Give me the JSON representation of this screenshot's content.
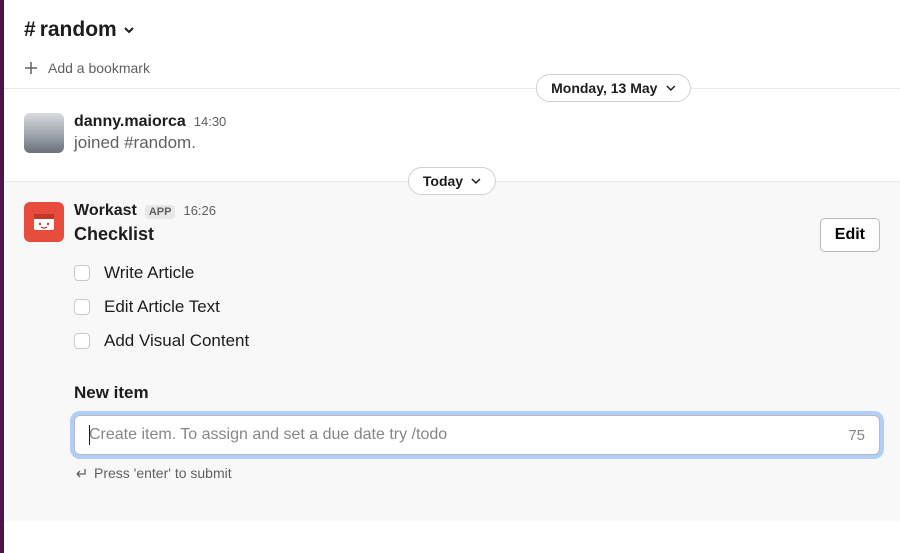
{
  "header": {
    "channel_name": "random",
    "add_bookmark": "Add a bookmark"
  },
  "date_separators": {
    "first": "Monday, 13 May",
    "second": "Today"
  },
  "join_message": {
    "author": "danny.maiorca",
    "time": "14:30",
    "text": "joined #random."
  },
  "workast": {
    "author": "Workast",
    "badge": "APP",
    "time": "16:26",
    "title": "Checklist",
    "edit_label": "Edit",
    "items": [
      "Write Article",
      "Edit Article Text",
      "Add Visual Content"
    ],
    "new_item_label": "New item",
    "input_placeholder": "Create item. To assign and set a due date try /todo",
    "char_count": "75",
    "submit_hint": "Press 'enter' to submit"
  }
}
